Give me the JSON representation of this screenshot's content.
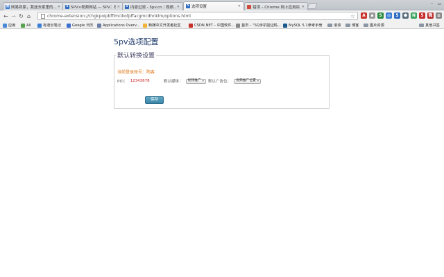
{
  "tabs": [
    {
      "title": "网易到家，我送去家里的...",
      "favicon_color": "#3a7bd5",
      "favicon_text": "易",
      "active": false
    },
    {
      "title": "5PV×视频网站 — 5PV：视频...",
      "favicon_color": "#2d6cc0",
      "favicon_text": "5",
      "active": false
    },
    {
      "title": "内容过滤 - 5pv.cn｜视频...",
      "favicon_color": "#2d6cc0",
      "favicon_text": "5",
      "active": false
    },
    {
      "title": "选项设置",
      "favicon_color": "#2d6cc0",
      "favicon_text": "5",
      "active": true
    },
    {
      "title": "错误 – Chrome 网上应用店",
      "favicon_color": "#d04a3a",
      "favicon_text": "",
      "active": false
    }
  ],
  "toolbar": {
    "url": "chrome-extension://chgkpoipbfflmcikofpffacgmcdhnklm/options.html"
  },
  "bookmarks": [
    {
      "label": "应用",
      "color": "#4a8ad4"
    },
    {
      "label": "All",
      "color": "#55a34c"
    },
    {
      "label": "有道云笔记",
      "color": "#3d7fd6"
    },
    {
      "label": "Google 日历",
      "color": "#3a6fcf"
    },
    {
      "label": "Applications Overv...",
      "color": "#6b7ea5"
    },
    {
      "label": "新媒中文开发者社区",
      "color": "#f0b23a"
    },
    {
      "label": "CSDN.NET – 中国软件...",
      "color": "#c8302a"
    },
    {
      "label": "首页 – \"SQ手机验证码...",
      "color": "#888888"
    },
    {
      "label": "MySQL 5.1参考手册",
      "color": "#1d5a8c"
    },
    {
      "label": "滚滚",
      "color": "folder"
    },
    {
      "label": "博客",
      "color": "folder"
    },
    {
      "label": "图片资源",
      "color": "folder"
    }
  ],
  "bookmarks_other": "其他书签",
  "page": {
    "title": "5pv选项配置",
    "legend": "默认转换设置",
    "account_text": "当前登录账号：陶客",
    "pid_label": "PID：",
    "pid_value": "12343678",
    "format_label": "默认媒体：",
    "format_value": "视频推广",
    "position_label": "默认广告位：",
    "position_value": "视频推广位置",
    "save_label": "保存"
  }
}
